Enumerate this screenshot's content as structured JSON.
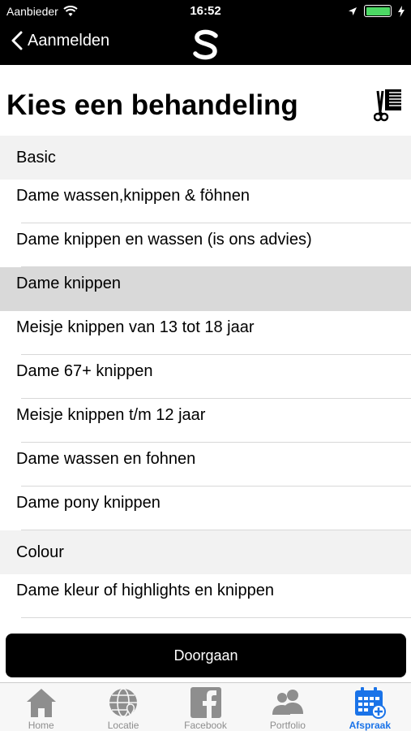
{
  "status": {
    "carrier": "Aanbieder",
    "time": "16:52",
    "battery_level": 1.0
  },
  "nav": {
    "back_label": "Aanmelden",
    "logo_letter": "S"
  },
  "page": {
    "title": "Kies een behandeling"
  },
  "sections": [
    {
      "header": "Basic",
      "items": [
        "Dame wassen,knippen & föhnen",
        "Dame knippen en wassen (is ons advies)",
        "Dame knippen",
        "Meisje knippen van 13 tot 18 jaar",
        "Dame 67+ knippen",
        "Meisje knippen t/m 12 jaar",
        "Dame wassen en fohnen",
        "Dame pony knippen"
      ]
    },
    {
      "header": "Colour",
      "items": [
        "Dame kleur of highlights en knippen"
      ]
    }
  ],
  "selected_item": "Dame knippen",
  "continue_label": "Doorgaan",
  "tabs": [
    {
      "label": "Home",
      "icon": "home-icon"
    },
    {
      "label": "Locatie",
      "icon": "globe-icon"
    },
    {
      "label": "Facebook",
      "icon": "facebook-icon"
    },
    {
      "label": "Portfolio",
      "icon": "people-icon"
    },
    {
      "label": "Afspraak",
      "icon": "calendar-add-icon",
      "active": true
    }
  ],
  "colors": {
    "accent": "#1a73e8",
    "inactive": "#8e8e8e",
    "bar": "#000000",
    "battery": "#4cd964"
  }
}
